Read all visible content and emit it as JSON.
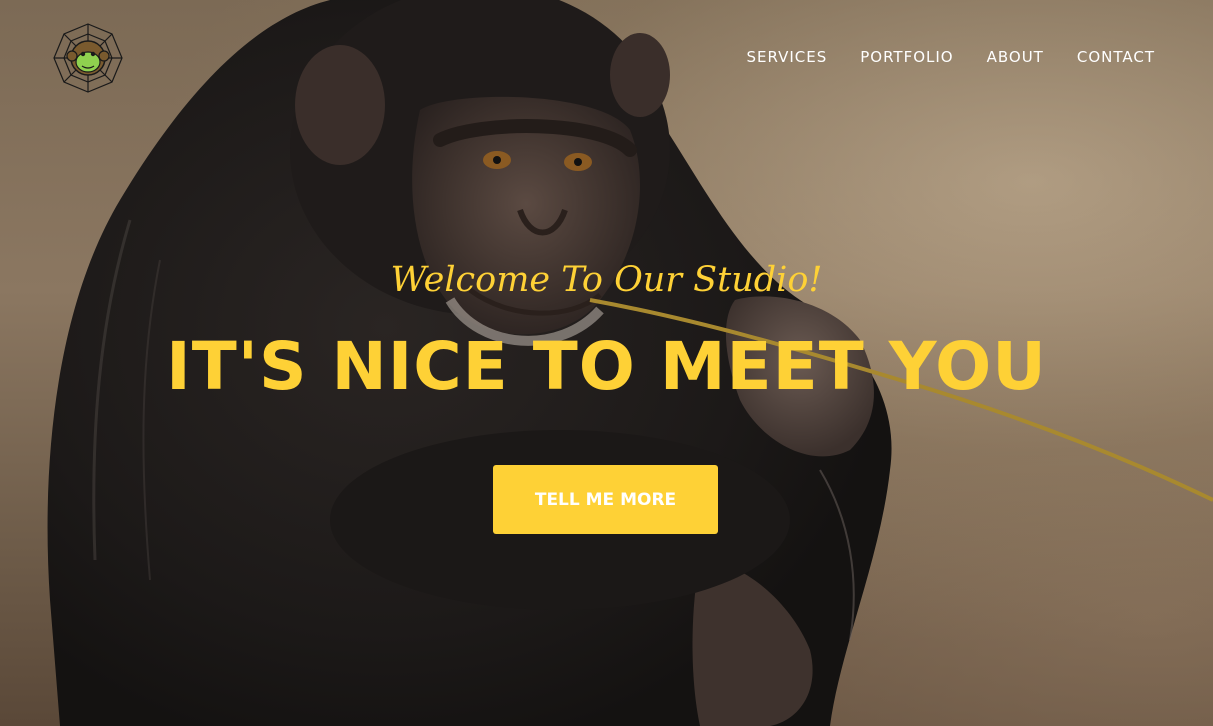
{
  "nav": {
    "logo_name": "monkey-web-logo",
    "links": [
      "SERVICES",
      "PORTFOLIO",
      "ABOUT",
      "CONTACT"
    ]
  },
  "intro": {
    "lead": "Welcome To Our Studio!",
    "heading": "IT'S NICE TO MEET YOU",
    "button": "TELL ME MORE"
  },
  "colors": {
    "accent": "#fed136",
    "nav_text": "#ffffff"
  }
}
